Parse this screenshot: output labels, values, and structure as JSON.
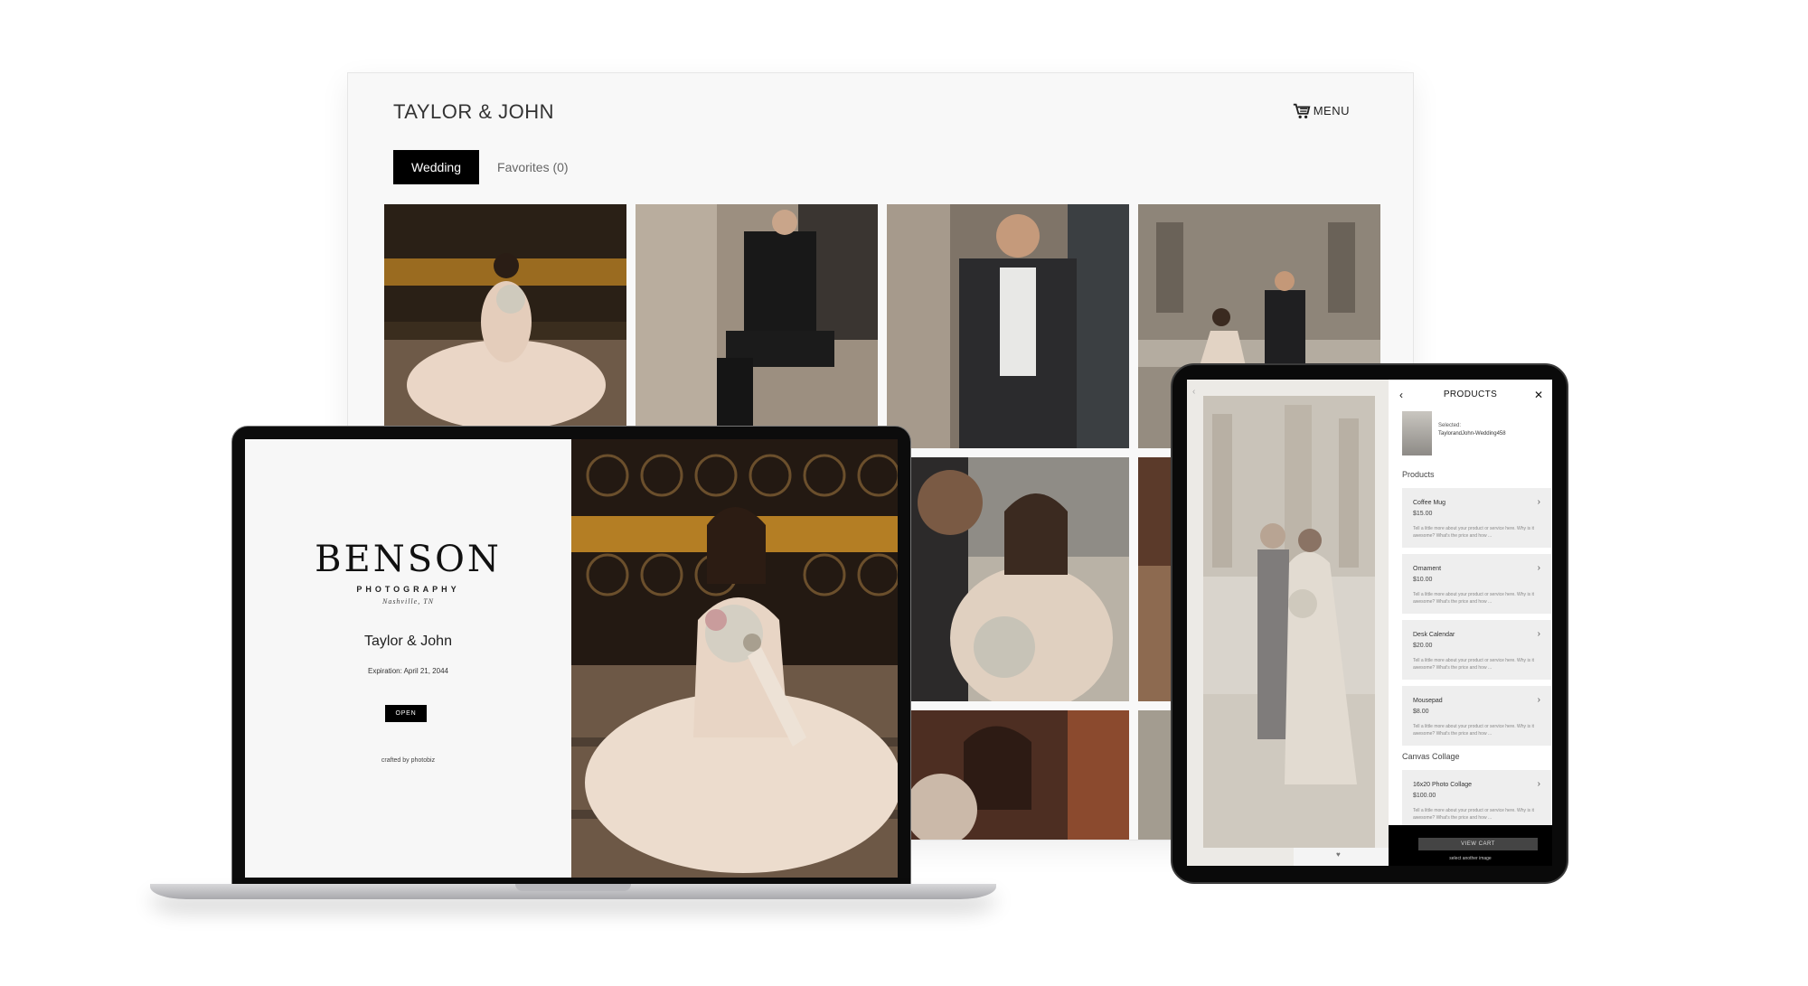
{
  "desktop": {
    "title": "TAYLOR & JOHN",
    "menu_label": "MENU",
    "cart_icon": "cart-icon",
    "tabs": [
      {
        "label": "Wedding",
        "active": true
      },
      {
        "label": "Favorites (0)",
        "active": false
      }
    ]
  },
  "laptop": {
    "brand": "BENSON",
    "brand_sub": "PHOTOGRAPHY",
    "location": "Nashville, TN",
    "couple": "Taylor & John",
    "expiration": "Expiration: April 21, 2044",
    "open_label": "OPEN",
    "crafted": "crafted by photobiz"
  },
  "tablet": {
    "panel_title": "PRODUCTS",
    "back_icon": "chevron-left-icon",
    "close_icon": "close-icon",
    "selected_label": "Selected:",
    "selected_name": "TaylorandJohn-Wedding458",
    "section_products": "Products",
    "products": [
      {
        "name": "Coffee Mug",
        "price": "$15.00",
        "desc": "Tell a little more about your product or service here. Why is it awesome? What's the price and how ..."
      },
      {
        "name": "Ornament",
        "price": "$10.00",
        "desc": "Tell a little more about your product or service here. Why is it awesome? What's the price and how ..."
      },
      {
        "name": "Desk Calendar",
        "price": "$20.00",
        "desc": "Tell a little more about your product or service here. Why is it awesome? What's the price and how ..."
      },
      {
        "name": "Mousepad",
        "price": "$8.00",
        "desc": "Tell a little more about your product or service here. Why is it awesome? What's the price and how ..."
      }
    ],
    "section_canvas": "Canvas Collage",
    "canvas_products": [
      {
        "name": "16x20 Photo Collage",
        "price": "$100.00",
        "desc": "Tell a little more about your product or service here. Why is it awesome? What's the price and how ..."
      }
    ],
    "view_cart": "VIEW CART",
    "select_another": "select another image"
  }
}
